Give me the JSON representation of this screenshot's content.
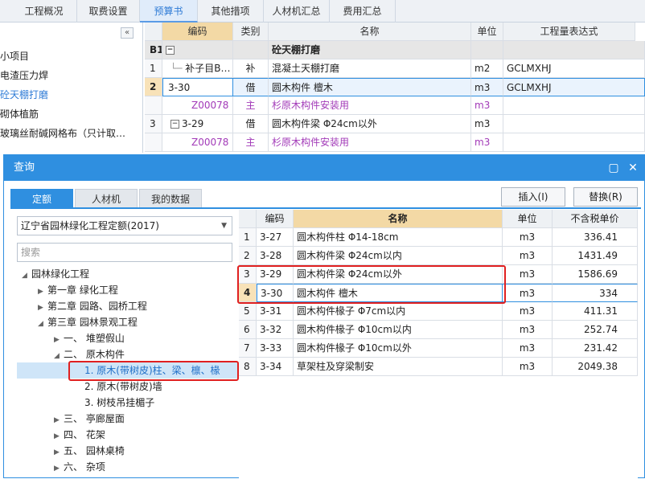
{
  "top_tabs": [
    "工程概况",
    "取费设置",
    "预算书",
    "其他措项",
    "人材机汇总",
    "费用汇总"
  ],
  "left_panel": {
    "collapse_label": "«",
    "items": [
      "小项目",
      "电渣压力焊",
      "砼天棚打磨",
      "砌体植筋",
      "玻璃丝耐碱网格布（只计取…"
    ]
  },
  "grid": {
    "headers": [
      "编码",
      "类别",
      "名称",
      "单位",
      "工程量表达式"
    ],
    "rows": [
      {
        "rn": "B1",
        "code": "",
        "type": "",
        "name": "砼天棚打磨",
        "unit": "",
        "expr": ""
      },
      {
        "rn": "1",
        "code": "补子目B…",
        "type": "补",
        "name": "混凝土天棚打磨",
        "unit": "m2",
        "expr": "GCLMXHJ"
      },
      {
        "rn": "2",
        "code": "3-30",
        "type": "借",
        "name": "圆木构件 檀木",
        "unit": "m3",
        "expr": "GCLMXHJ"
      },
      {
        "rn": "",
        "code": "Z00078",
        "type": "主",
        "name": "杉原木构件安装用",
        "unit": "m3",
        "expr": ""
      },
      {
        "rn": "3",
        "code": "3-29",
        "type": "借",
        "name": "圆木构件梁 Φ24cm以外",
        "unit": "m3",
        "expr": ""
      },
      {
        "rn": "",
        "code": "Z00078",
        "type": "主",
        "name": "杉原木构件安装用",
        "unit": "m3",
        "expr": ""
      }
    ]
  },
  "dialog": {
    "title": "查询",
    "tabs": [
      "定额",
      "人材机",
      "我的数据"
    ],
    "insert_button": "插入(I)",
    "replace_button": "替换(R)",
    "quota_select": "辽宁省园林绿化工程定额(2017)",
    "search_placeholder": "搜索",
    "tree": [
      "园林绿化工程",
      "第一章 绿化工程",
      "第二章 园路、园桥工程",
      "第三章 园林景观工程",
      "一、 堆塑假山",
      "二、 原木构件",
      "1. 原木(带树皮)柱、梁、檩、椽",
      "2. 原木(带树皮)墙",
      "3. 树枝吊挂楣子",
      "三、 亭廊屋面",
      "四、 花架",
      "五、 园林桌椅",
      "六、 杂项"
    ],
    "table": {
      "headers": [
        "编码",
        "名称",
        "单位",
        "不含税单价"
      ],
      "rows": [
        {
          "rn": "1",
          "code": "3-27",
          "name": "圆木构件柱 Φ14-18cm",
          "unit": "m3",
          "price": "336.41"
        },
        {
          "rn": "2",
          "code": "3-28",
          "name": "圆木构件梁 Φ24cm以内",
          "unit": "m3",
          "price": "1431.49"
        },
        {
          "rn": "3",
          "code": "3-29",
          "name": "圆木构件梁 Φ24cm以外",
          "unit": "m3",
          "price": "1586.69"
        },
        {
          "rn": "4",
          "code": "3-30",
          "name": "圆木构件 檀木",
          "unit": "m3",
          "price": "334"
        },
        {
          "rn": "5",
          "code": "3-31",
          "name": "圆木构件椽子 Φ7cm以内",
          "unit": "m3",
          "price": "411.31"
        },
        {
          "rn": "6",
          "code": "3-32",
          "name": "圆木构件椽子 Φ10cm以内",
          "unit": "m3",
          "price": "252.74"
        },
        {
          "rn": "7",
          "code": "3-33",
          "name": "圆木构件椽子 Φ10cm以外",
          "unit": "m3",
          "price": "231.42"
        },
        {
          "rn": "8",
          "code": "3-34",
          "name": "草架柱及穿梁制安",
          "unit": "m3",
          "price": "2049.38"
        }
      ]
    }
  },
  "colors": {
    "accent": "#2f8fe0",
    "highlight_red": "#e02020",
    "main_material": "#a23ab8"
  }
}
